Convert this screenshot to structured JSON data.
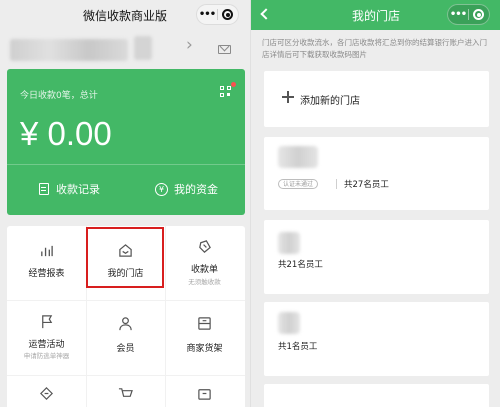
{
  "left": {
    "nav_title": "微信收款商业版",
    "capsule_dots": "•••",
    "today_summary": "今日收款0笔，总计",
    "amount": "¥ 0.00",
    "btn_records": "收款记录",
    "btn_funds": "我的资金",
    "grid": [
      {
        "label": "经营报表",
        "sub": "",
        "icon": "bar-chart-icon"
      },
      {
        "label": "我的门店",
        "sub": "",
        "icon": "store-icon"
      },
      {
        "label": "收款单",
        "sub": "无须触收款",
        "icon": "receipt-tag-icon"
      },
      {
        "label": "运营活动",
        "sub": "申请防逃单神器",
        "icon": "flag-icon"
      },
      {
        "label": "会员",
        "sub": "",
        "icon": "member-icon"
      },
      {
        "label": "商家货架",
        "sub": "",
        "icon": "shelf-icon"
      }
    ],
    "colors": {
      "green": "#43b866",
      "highlight": "#d81e1e"
    }
  },
  "right": {
    "nav_title": "我的门店",
    "capsule_dots": "•••",
    "notice": "门店可区分收款流水，各门店收款将汇总到你的结算银行账户进入门店详情后可下载获取收款码图片",
    "add_store": "添加新的门店",
    "stores": [
      {
        "tag": "认证未通过",
        "count": "共27名员工"
      },
      {
        "tag": "",
        "count": "共21名员工"
      },
      {
        "tag": "",
        "count": "共1名员工"
      }
    ]
  }
}
